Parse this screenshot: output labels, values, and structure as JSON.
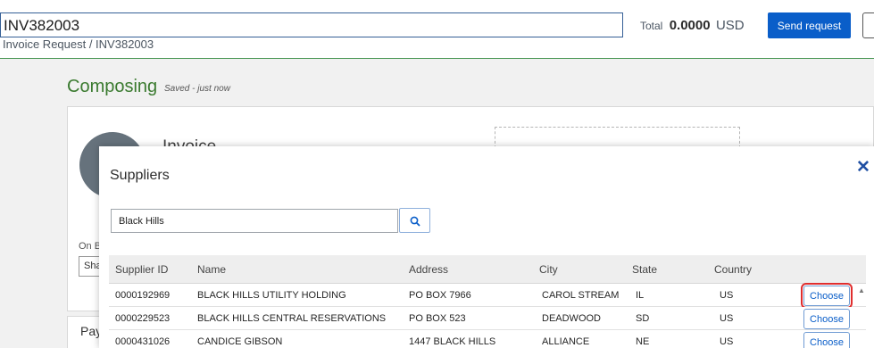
{
  "header": {
    "title": "INV382003",
    "total_label": "Total",
    "total_value": "0.0000",
    "total_currency": "USD",
    "send_button": "Send request",
    "breadcrumb": "Invoice Request  /  INV382003"
  },
  "page": {
    "status": "Composing",
    "saved": "Saved - just now",
    "card_title": "Invoice",
    "on_behalf_label": "On B",
    "share_button": "Sha",
    "payment_label": "Pay"
  },
  "modal": {
    "title": "Suppliers",
    "close_icon": "close-icon",
    "search": {
      "value": "Black Hills",
      "icon": "search-icon"
    },
    "columns": [
      "Supplier ID",
      "Name",
      "Address",
      "City",
      "State",
      "Country"
    ],
    "rows": [
      {
        "id": "0000192969",
        "name": "BLACK HILLS UTILITY HOLDING",
        "address": "PO BOX 7966",
        "city": "CAROL STREAM",
        "state": "IL",
        "country": "US",
        "action": "Choose"
      },
      {
        "id": "0000229523",
        "name": "BLACK HILLS CENTRAL RESERVATIONS",
        "address": "PO BOX 523",
        "city": "DEADWOOD",
        "state": "SD",
        "country": "US",
        "action": "Choose"
      },
      {
        "id": "0000431026",
        "name": "CANDICE GIBSON",
        "address": "1447 BLACK HILLS",
        "city": "ALLIANCE",
        "state": "NE",
        "country": "US",
        "action": "Choose"
      }
    ]
  },
  "colors": {
    "primary": "#0a5ec9",
    "brand_green": "#3a7a2f",
    "highlight": "#e02e2e"
  }
}
